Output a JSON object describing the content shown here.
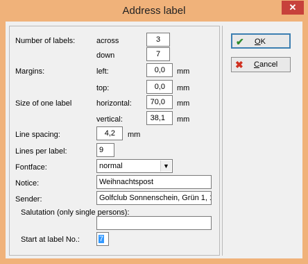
{
  "window": {
    "title": "Address label",
    "close_glyph": "✕"
  },
  "labels": {
    "number_of_labels": "Number of labels:",
    "across": "across",
    "down": "down",
    "margins": "Margins:",
    "left": "left:",
    "top": "top:",
    "size_of_one_label": "Size of one label",
    "horizontal": "horizontal:",
    "vertical": "vertical:",
    "line_spacing": "Line spacing:",
    "lines_per_label": "Lines per label:",
    "fontface": "Fontface:",
    "notice": "Notice:",
    "sender": "Sender:",
    "salutation": "Salutation (only single persons):",
    "start_at_label": "Start at label No.:",
    "unit_mm": "mm"
  },
  "values": {
    "across": "3",
    "down": "7",
    "margin_left": "0,0",
    "margin_top": "0,0",
    "horizontal": "70,0",
    "vertical": "38,1",
    "line_spacing": "4,2",
    "lines_per_label": "9",
    "fontface": "normal",
    "notice": "Weihnachtspost",
    "sender": "Golfclub Sonnenschein, Grün 1, 1",
    "salutation": "",
    "start_at_label": "7"
  },
  "buttons": {
    "ok_prefix": "",
    "ok_underlined": "O",
    "ok_rest": "K",
    "cancel_underlined": "C",
    "cancel_rest": "ancel"
  },
  "icons": {
    "ok": "checkmark-icon",
    "cancel": "x-icon",
    "dropdown": "chevron-down-icon"
  },
  "colors": {
    "titlebar": "#f0b27a",
    "close": "#c7413b",
    "ok_icon": "#2e8b2e",
    "cancel_icon": "#d03020",
    "selection": "#3399ff"
  }
}
